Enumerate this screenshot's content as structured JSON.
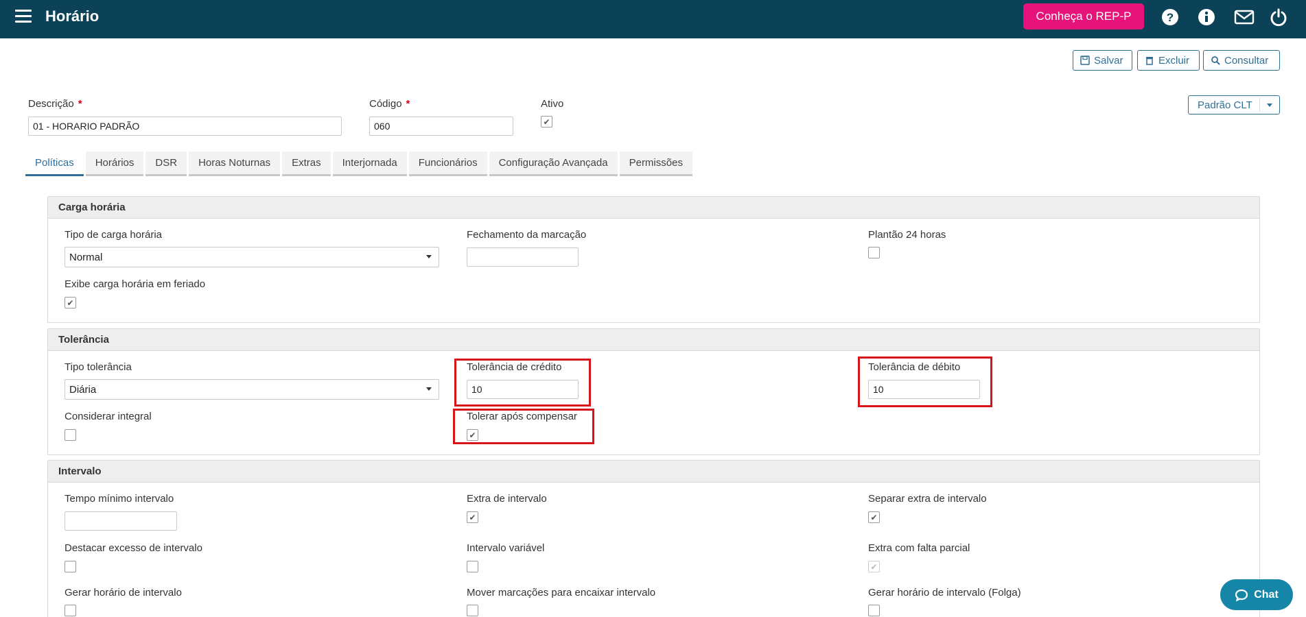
{
  "header": {
    "title": "Horário",
    "rep_button": "Conheça o REP-P"
  },
  "actions": {
    "save": "Salvar",
    "delete": "Excluir",
    "search": "Consultar"
  },
  "form": {
    "descricao_label": "Descrição",
    "descricao_value": "01 - HORARIO PADRÃO",
    "codigo_label": "Código",
    "codigo_value": "060",
    "ativo_label": "Ativo",
    "required_mark": "*"
  },
  "preset_dropdown": "Padrão CLT",
  "tabs": [
    "Políticas",
    "Horários",
    "DSR",
    "Horas Noturnas",
    "Extras",
    "Interjornada",
    "Funcionários",
    "Configuração Avançada",
    "Permissões"
  ],
  "carga": {
    "title": "Carga horária",
    "tipo_label": "Tipo de carga horária",
    "tipo_value": "Normal",
    "fechamento_label": "Fechamento da marcação",
    "plantao_label": "Plantão 24 horas",
    "exibe_label": "Exibe carga horária em feriado"
  },
  "tolerancia": {
    "title": "Tolerância",
    "tipo_label": "Tipo tolerância",
    "tipo_value": "Diária",
    "credito_label": "Tolerância de crédito",
    "credito_value": "10",
    "debito_label": "Tolerância de débito",
    "debito_value": "10",
    "integral_label": "Considerar integral",
    "compensar_label": "Tolerar após compensar"
  },
  "intervalo": {
    "title": "Intervalo",
    "tempo_label": "Tempo mínimo intervalo",
    "extra_label": "Extra de intervalo",
    "separar_label": "Separar extra de intervalo",
    "destacar_label": "Destacar excesso de intervalo",
    "variavel_label": "Intervalo variável",
    "falta_label": "Extra com falta parcial",
    "gerar_label": "Gerar horário de intervalo",
    "mover_label": "Mover marcações para encaixar intervalo",
    "folga_label": "Gerar horário de intervalo (Folga)"
  },
  "chat": "Chat",
  "colors": {
    "topbar": "#0b4257",
    "accent": "#2f6f97",
    "rep": "#e6137a",
    "highlight": "#d7141a",
    "chat": "#1586a8"
  }
}
